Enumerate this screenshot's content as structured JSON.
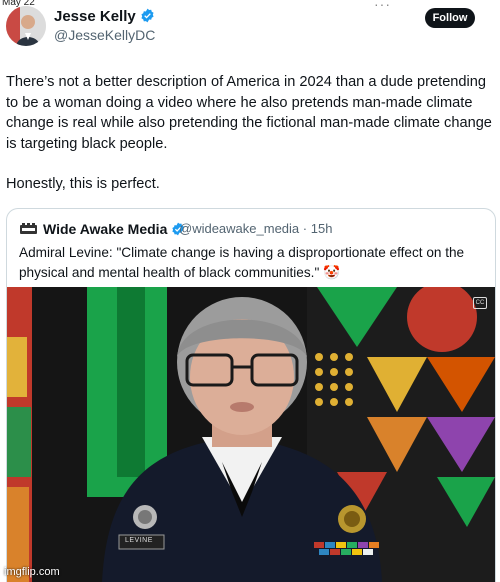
{
  "status": {
    "date": "May 22",
    "more_dots": "···"
  },
  "author": {
    "name": "Jesse Kelly",
    "handle": "@JesseKellyDC",
    "verified_color": "#1d9bf0"
  },
  "follow_label": "Follow",
  "tweet": {
    "paragraph1": "There’s not a better description of America in 2024 than a dude pretending to be a woman doing a video where he also pretends man-made climate change is real while also pretending the fictional man-made climate change is targeting black people.",
    "paragraph2": "Honestly, this is perfect."
  },
  "quote": {
    "name": "Wide Awake Media",
    "handle": "@wideawake_media",
    "time": "15h",
    "text": "Admiral Levine: \"Climate change is having a disproportionate effect on the physical and mental health of black communities.\" 🤡",
    "video": {
      "nametag": "LEVINE"
    }
  },
  "watermark": "imgflip.com"
}
